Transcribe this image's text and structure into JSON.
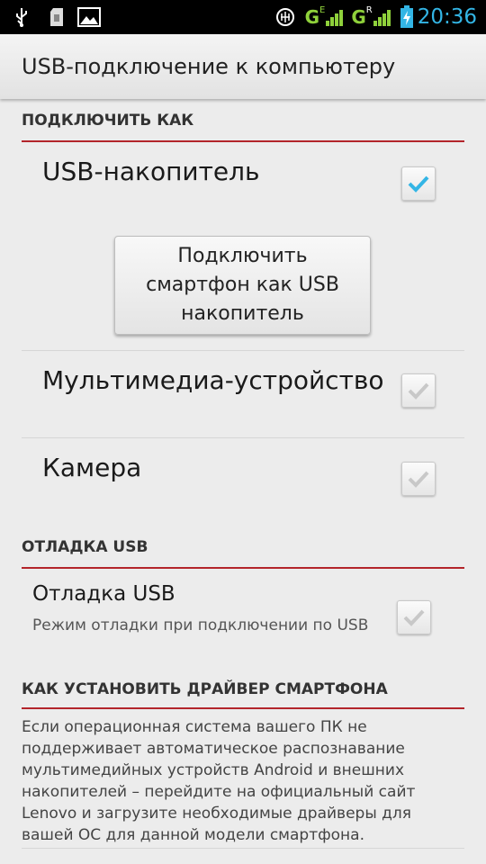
{
  "status_bar": {
    "icons": [
      "usb-icon",
      "sd-card-icon",
      "image-icon",
      "vpn-icon",
      "signal-icon",
      "signal-icon",
      "battery-charging-icon"
    ],
    "network_1": "G",
    "network_1_sup": "E",
    "network_2": "G",
    "network_2_sup": "R",
    "clock": "20:36"
  },
  "header": {
    "title": "USB-подключение к компьютеру"
  },
  "section_connect": {
    "title": "ПОДКЛЮЧИТЬ КАК",
    "items": [
      {
        "label": "USB-накопитель",
        "checked": true
      },
      {
        "label": "Мультимедиа-устройство",
        "checked": false
      },
      {
        "label": "Камера",
        "checked": false
      }
    ],
    "button_label": "Подключить смартфон как USB накопитель"
  },
  "section_debug": {
    "title": "ОТЛАДКА USB",
    "item": {
      "label": "Отладка USB",
      "summary": "Режим отладки при подключении по USB",
      "checked": false
    }
  },
  "section_driver": {
    "title": "КАК УСТАНОВИТЬ ДРАЙВЕР СМАРТФОНА",
    "text": "Если операционная система вашего ПК не поддерживает автоматическое распознавание мультимедийных устройств Android и внешних накопителей – перейдите на официальный сайт Lenovo и загрузите необходимые драйверы для вашей ОС для данной модели смартфона."
  },
  "colors": {
    "accent": "#b3252b",
    "check_on": "#33b5e5",
    "check_off": "#c8c8c8",
    "clock": "#33b5e5"
  }
}
